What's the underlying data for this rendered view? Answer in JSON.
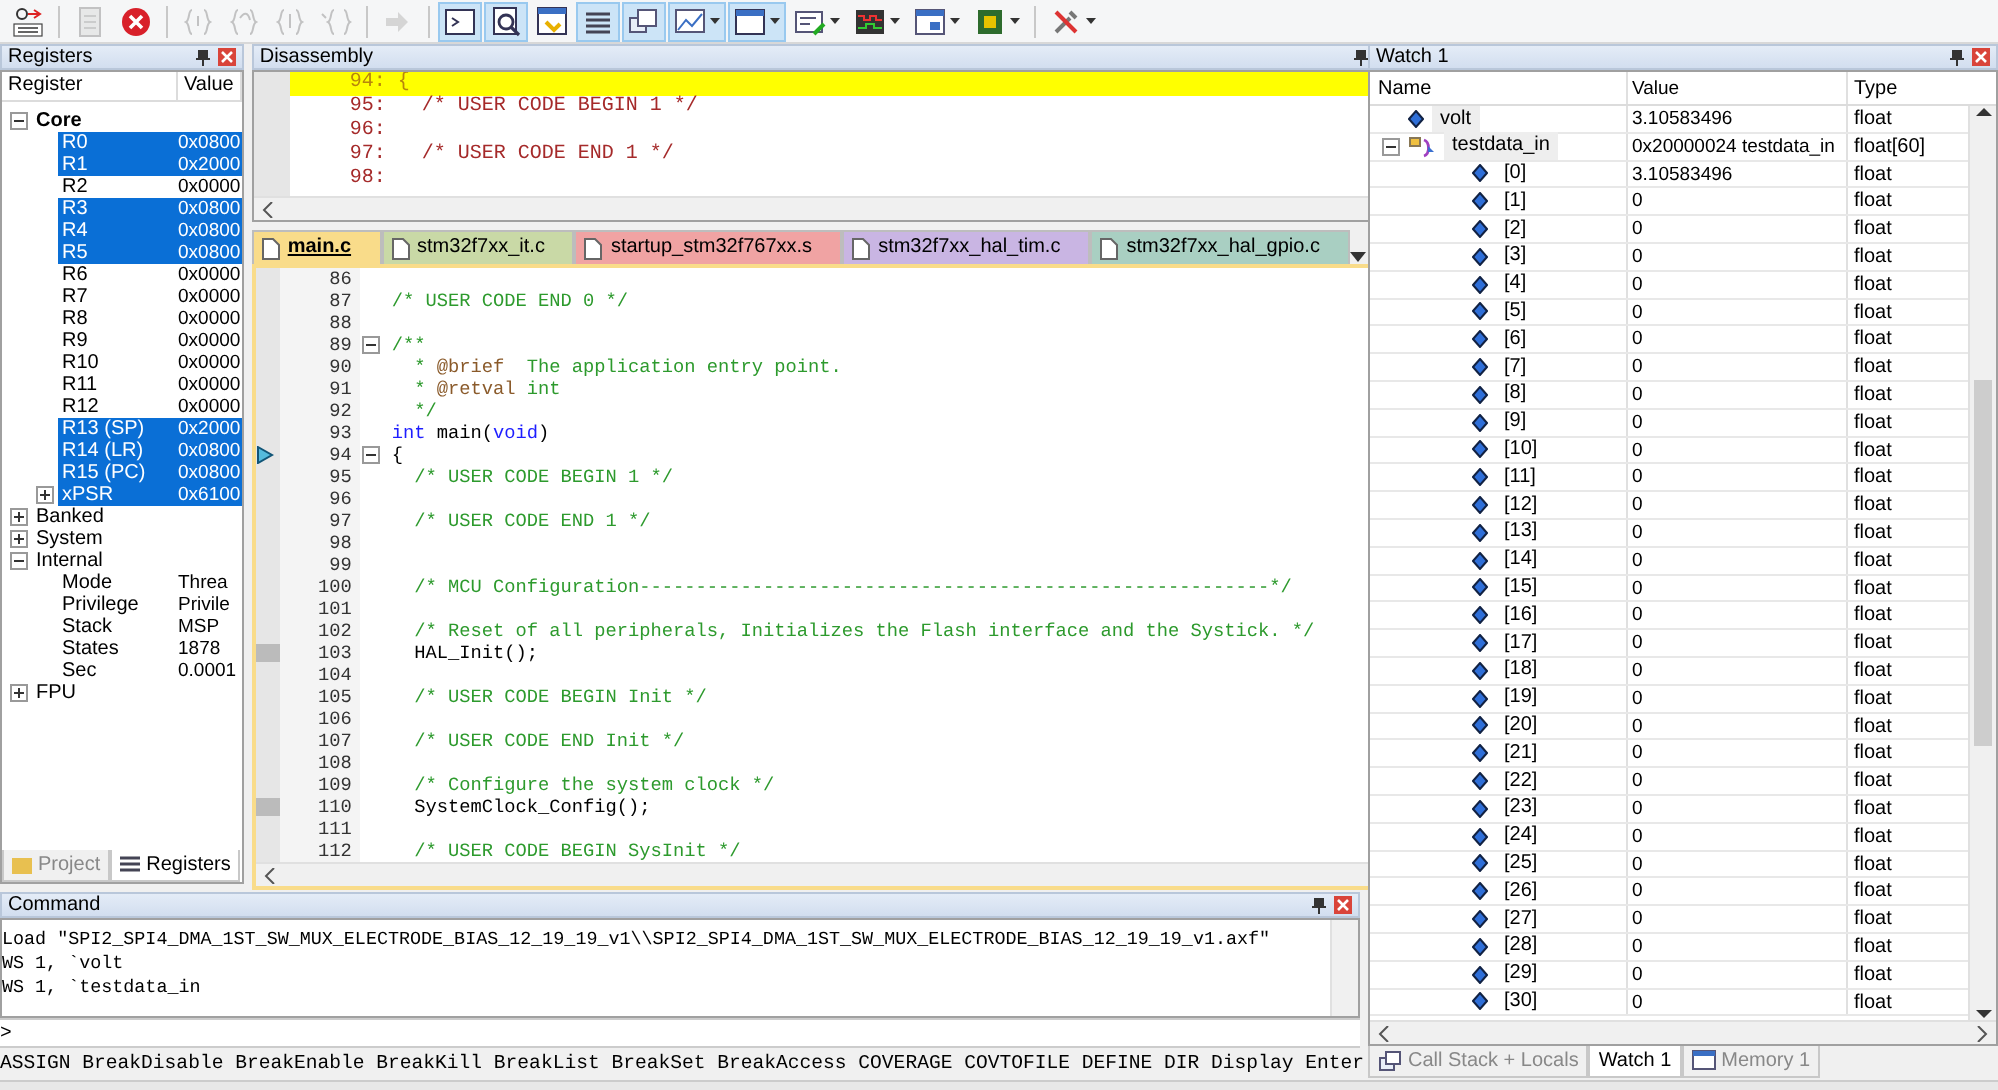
{
  "toolbar": [
    {
      "kind": "reset",
      "pressed": false,
      "disabled": false,
      "dropdown": false
    },
    {
      "kind": "separator"
    },
    {
      "kind": "run",
      "pressed": false,
      "disabled": true,
      "dropdown": false
    },
    {
      "kind": "stop",
      "pressed": false,
      "disabled": false,
      "dropdown": false
    },
    {
      "kind": "separator"
    },
    {
      "kind": "step-into",
      "pressed": false,
      "disabled": true,
      "dropdown": false
    },
    {
      "kind": "step-over",
      "pressed": false,
      "disabled": true,
      "dropdown": false
    },
    {
      "kind": "step-out",
      "pressed": false,
      "disabled": true,
      "dropdown": false
    },
    {
      "kind": "run-to-cursor",
      "pressed": false,
      "disabled": true,
      "dropdown": false
    },
    {
      "kind": "separator"
    },
    {
      "kind": "show-next",
      "pressed": false,
      "disabled": true,
      "dropdown": false
    },
    {
      "kind": "separator"
    },
    {
      "kind": "command-window",
      "pressed": true,
      "disabled": false,
      "dropdown": false
    },
    {
      "kind": "disassembly-window",
      "pressed": true,
      "disabled": false,
      "dropdown": false
    },
    {
      "kind": "symbols-window",
      "pressed": false,
      "disabled": false,
      "dropdown": false
    },
    {
      "kind": "registers-window",
      "pressed": true,
      "disabled": false,
      "dropdown": false
    },
    {
      "kind": "call-stack-window",
      "pressed": true,
      "disabled": false,
      "dropdown": false
    },
    {
      "kind": "watch-window",
      "pressed": true,
      "disabled": false,
      "dropdown": true
    },
    {
      "kind": "memory-window",
      "pressed": true,
      "disabled": false,
      "dropdown": true
    },
    {
      "kind": "serial-window",
      "pressed": false,
      "disabled": false,
      "dropdown": true
    },
    {
      "kind": "analysis-window",
      "pressed": false,
      "disabled": false,
      "dropdown": true
    },
    {
      "kind": "trace-window",
      "pressed": false,
      "disabled": false,
      "dropdown": true
    },
    {
      "kind": "system-viewer",
      "pressed": false,
      "disabled": false,
      "dropdown": true
    },
    {
      "kind": "separator"
    },
    {
      "kind": "toolbox",
      "pressed": false,
      "disabled": false,
      "dropdown": true
    }
  ],
  "registers": {
    "title": "Registers",
    "columns": [
      "Register",
      "Value"
    ],
    "groups": [
      {
        "name": "Core",
        "expanded": true,
        "children": [
          {
            "name": "R0",
            "value": "0x0800",
            "selected": true
          },
          {
            "name": "R1",
            "value": "0x2000",
            "selected": true
          },
          {
            "name": "R2",
            "value": "0x0000",
            "selected": false
          },
          {
            "name": "R3",
            "value": "0x0800",
            "selected": true
          },
          {
            "name": "R4",
            "value": "0x0800",
            "selected": true
          },
          {
            "name": "R5",
            "value": "0x0800",
            "selected": true
          },
          {
            "name": "R6",
            "value": "0x0000",
            "selected": false
          },
          {
            "name": "R7",
            "value": "0x0000",
            "selected": false
          },
          {
            "name": "R8",
            "value": "0x0000",
            "selected": false
          },
          {
            "name": "R9",
            "value": "0x0000",
            "selected": false
          },
          {
            "name": "R10",
            "value": "0x0000",
            "selected": false
          },
          {
            "name": "R11",
            "value": "0x0000",
            "selected": false
          },
          {
            "name": "R12",
            "value": "0x0000",
            "selected": false
          },
          {
            "name": "R13 (SP)",
            "value": "0x2000",
            "selected": true
          },
          {
            "name": "R14 (LR)",
            "value": "0x0800",
            "selected": true
          },
          {
            "name": "R15 (PC)",
            "value": "0x0800",
            "selected": true
          },
          {
            "name": "xPSR",
            "value": "0x6100",
            "selected": true,
            "expanded": false
          }
        ]
      },
      {
        "name": "Banked",
        "expanded": false
      },
      {
        "name": "System",
        "expanded": false
      },
      {
        "name": "Internal",
        "expanded": true,
        "children": [
          {
            "name": "Mode",
            "value": "Threa",
            "selected": false
          },
          {
            "name": "Privilege",
            "value": "Privile",
            "selected": false
          },
          {
            "name": "Stack",
            "value": "MSP",
            "selected": false
          },
          {
            "name": "States",
            "value": "1878",
            "selected": false
          },
          {
            "name": "Sec",
            "value": "0.0001",
            "selected": false
          }
        ]
      },
      {
        "name": "FPU",
        "expanded": false
      }
    ],
    "tabs": [
      {
        "label": "Project",
        "selected": false
      },
      {
        "label": "Registers",
        "selected": true
      }
    ]
  },
  "disassembly": {
    "title": "Disassembly",
    "lines": [
      {
        "text": "94: {",
        "current": true
      },
      {
        "text": "95:   /* USER CODE BEGIN 1 */",
        "current": false
      },
      {
        "text": "96:",
        "current": false
      },
      {
        "text": "97:   /* USER CODE END 1 */",
        "current": false
      },
      {
        "text": "98:",
        "current": false
      }
    ]
  },
  "editor": {
    "tabs": [
      {
        "label": "main.c",
        "selected": true,
        "color": "#f9dc8a"
      },
      {
        "label": "stm32f7xx_it.c",
        "selected": false,
        "color": "#c9d9a6"
      },
      {
        "label": "startup_stm32f767xx.s",
        "selected": false,
        "color": "#f0a3a3"
      },
      {
        "label": "stm32f7xx_hal_tim.c",
        "selected": false,
        "color": "#c9b5e3"
      },
      {
        "label": "stm32f7xx_hal_gpio.c",
        "selected": false,
        "color": "#a9cfc2"
      }
    ],
    "lines": [
      {
        "number": "86",
        "current": false,
        "code_mark": false,
        "fold": false
      },
      {
        "number": "87",
        "current": false,
        "code_mark": false,
        "fold": false,
        "segments": [
          {
            "kind": "comment",
            "text": "/* USER CODE END 0 */"
          }
        ]
      },
      {
        "number": "88",
        "current": false,
        "code_mark": false,
        "fold": false
      },
      {
        "number": "89",
        "current": false,
        "code_mark": false,
        "fold": true,
        "segments": [
          {
            "kind": "comment",
            "text": "/**"
          }
        ]
      },
      {
        "number": "90",
        "current": false,
        "code_mark": false,
        "fold": false,
        "segments": [
          {
            "kind": "comment",
            "text": "  * "
          },
          {
            "kind": "doctag",
            "text": "@brief"
          },
          {
            "kind": "comment",
            "text": "  The application entry point."
          }
        ]
      },
      {
        "number": "91",
        "current": false,
        "code_mark": false,
        "fold": false,
        "segments": [
          {
            "kind": "comment",
            "text": "  * "
          },
          {
            "kind": "doctag",
            "text": "@retval"
          },
          {
            "kind": "comment",
            "text": " int"
          }
        ]
      },
      {
        "number": "92",
        "current": false,
        "code_mark": false,
        "fold": false,
        "segments": [
          {
            "kind": "comment",
            "text": "  */"
          }
        ]
      },
      {
        "number": "93",
        "current": false,
        "code_mark": false,
        "fold": false,
        "segments": [
          {
            "kind": "keyword",
            "text": "int"
          },
          {
            "kind": "plain",
            "text": " main("
          },
          {
            "kind": "keyword",
            "text": "void"
          },
          {
            "kind": "plain",
            "text": ")"
          }
        ]
      },
      {
        "number": "94",
        "current": true,
        "code_mark": false,
        "fold": true,
        "segments": [
          {
            "kind": "plain",
            "text": "{"
          }
        ]
      },
      {
        "number": "95",
        "current": false,
        "code_mark": false,
        "fold": false,
        "segments": [
          {
            "kind": "comment",
            "text": "  /* USER CODE BEGIN 1 */"
          }
        ]
      },
      {
        "number": "96",
        "current": false,
        "code_mark": false,
        "fold": false
      },
      {
        "number": "97",
        "current": false,
        "code_mark": false,
        "fold": false,
        "segments": [
          {
            "kind": "comment",
            "text": "  /* USER CODE END 1 */"
          }
        ]
      },
      {
        "number": "98",
        "current": false,
        "code_mark": false,
        "fold": false
      },
      {
        "number": "99",
        "current": false,
        "code_mark": false,
        "fold": false
      },
      {
        "number": "100",
        "current": false,
        "code_mark": false,
        "fold": false,
        "segments": [
          {
            "kind": "comment",
            "text": "  /* MCU Configuration--------------------------------------------------------*/"
          }
        ]
      },
      {
        "number": "101",
        "current": false,
        "code_mark": false,
        "fold": false
      },
      {
        "number": "102",
        "current": false,
        "code_mark": false,
        "fold": false,
        "segments": [
          {
            "kind": "comment",
            "text": "  /* Reset of all peripherals, Initializes the Flash interface and the Systick. */"
          }
        ]
      },
      {
        "number": "103",
        "current": false,
        "code_mark": true,
        "fold": false,
        "segments": [
          {
            "kind": "plain",
            "text": "  HAL_Init();"
          }
        ]
      },
      {
        "number": "104",
        "current": false,
        "code_mark": false,
        "fold": false
      },
      {
        "number": "105",
        "current": false,
        "code_mark": false,
        "fold": false,
        "segments": [
          {
            "kind": "comment",
            "text": "  /* USER CODE BEGIN Init */"
          }
        ]
      },
      {
        "number": "106",
        "current": false,
        "code_mark": false,
        "fold": false
      },
      {
        "number": "107",
        "current": false,
        "code_mark": false,
        "fold": false,
        "segments": [
          {
            "kind": "comment",
            "text": "  /* USER CODE END Init */"
          }
        ]
      },
      {
        "number": "108",
        "current": false,
        "code_mark": false,
        "fold": false
      },
      {
        "number": "109",
        "current": false,
        "code_mark": false,
        "fold": false,
        "segments": [
          {
            "kind": "comment",
            "text": "  /* Configure the system clock */"
          }
        ]
      },
      {
        "number": "110",
        "current": false,
        "code_mark": true,
        "fold": false,
        "segments": [
          {
            "kind": "plain",
            "text": "  SystemClock_Config();"
          }
        ]
      },
      {
        "number": "111",
        "current": false,
        "code_mark": false,
        "fold": false
      },
      {
        "number": "112",
        "current": false,
        "code_mark": false,
        "fold": false,
        "segments": [
          {
            "kind": "comment",
            "text": "  /* USER CODE BEGIN SysInit */"
          }
        ]
      }
    ]
  },
  "command": {
    "title": "Command",
    "output": [
      "Load \"SPI2_SPI4_DMA_1ST_SW_MUX_ELECTRODE_BIAS_12_19_19_v1\\\\SPI2_SPI4_DMA_1ST_SW_MUX_ELECTRODE_BIAS_12_19_19_v1.axf\"",
      "WS 1, `volt",
      "WS 1, `testdata_in"
    ],
    "prompt": ">",
    "help_line": "ASSIGN BreakDisable BreakEnable BreakKill BreakList BreakSet BreakAccess COVERAGE COVTOFILE DEFINE DIR Display Enter"
  },
  "watch": {
    "title": "Watch 1",
    "columns": [
      "Name",
      "Value",
      "Type"
    ],
    "items": [
      {
        "kind": "variable",
        "name": "volt",
        "value": "3.10583496",
        "type": "float"
      },
      {
        "kind": "array",
        "name": "testdata_in",
        "value": "0x20000024 testdata_in",
        "type": "float[60]",
        "expanded": true,
        "children": [
          {
            "kind": "variable",
            "name": "[0]",
            "value": "3.10583496",
            "type": "float"
          },
          {
            "kind": "variable",
            "name": "[1]",
            "value": "0",
            "type": "float"
          },
          {
            "kind": "variable",
            "name": "[2]",
            "value": "0",
            "type": "float"
          },
          {
            "kind": "variable",
            "name": "[3]",
            "value": "0",
            "type": "float"
          },
          {
            "kind": "variable",
            "name": "[4]",
            "value": "0",
            "type": "float"
          },
          {
            "kind": "variable",
            "name": "[5]",
            "value": "0",
            "type": "float"
          },
          {
            "kind": "variable",
            "name": "[6]",
            "value": "0",
            "type": "float"
          },
          {
            "kind": "variable",
            "name": "[7]",
            "value": "0",
            "type": "float"
          },
          {
            "kind": "variable",
            "name": "[8]",
            "value": "0",
            "type": "float"
          },
          {
            "kind": "variable",
            "name": "[9]",
            "value": "0",
            "type": "float"
          },
          {
            "kind": "variable",
            "name": "[10]",
            "value": "0",
            "type": "float"
          },
          {
            "kind": "variable",
            "name": "[11]",
            "value": "0",
            "type": "float"
          },
          {
            "kind": "variable",
            "name": "[12]",
            "value": "0",
            "type": "float"
          },
          {
            "kind": "variable",
            "name": "[13]",
            "value": "0",
            "type": "float"
          },
          {
            "kind": "variable",
            "name": "[14]",
            "value": "0",
            "type": "float"
          },
          {
            "kind": "variable",
            "name": "[15]",
            "value": "0",
            "type": "float"
          },
          {
            "kind": "variable",
            "name": "[16]",
            "value": "0",
            "type": "float"
          },
          {
            "kind": "variable",
            "name": "[17]",
            "value": "0",
            "type": "float"
          },
          {
            "kind": "variable",
            "name": "[18]",
            "value": "0",
            "type": "float"
          },
          {
            "kind": "variable",
            "name": "[19]",
            "value": "0",
            "type": "float"
          },
          {
            "kind": "variable",
            "name": "[20]",
            "value": "0",
            "type": "float"
          },
          {
            "kind": "variable",
            "name": "[21]",
            "value": "0",
            "type": "float"
          },
          {
            "kind": "variable",
            "name": "[22]",
            "value": "0",
            "type": "float"
          },
          {
            "kind": "variable",
            "name": "[23]",
            "value": "0",
            "type": "float"
          },
          {
            "kind": "variable",
            "name": "[24]",
            "value": "0",
            "type": "float"
          },
          {
            "kind": "variable",
            "name": "[25]",
            "value": "0",
            "type": "float"
          },
          {
            "kind": "variable",
            "name": "[26]",
            "value": "0",
            "type": "float"
          },
          {
            "kind": "variable",
            "name": "[27]",
            "value": "0",
            "type": "float"
          },
          {
            "kind": "variable",
            "name": "[28]",
            "value": "0",
            "type": "float"
          },
          {
            "kind": "variable",
            "name": "[29]",
            "value": "0",
            "type": "float"
          },
          {
            "kind": "variable",
            "name": "[30]",
            "value": "0",
            "type": "float"
          }
        ]
      }
    ],
    "tabs": [
      {
        "label": "Call Stack + Locals",
        "kind": "callstack",
        "selected": false
      },
      {
        "label": "Watch 1",
        "kind": "watch",
        "selected": true
      },
      {
        "label": "Memory 1",
        "kind": "memory",
        "selected": false
      }
    ]
  }
}
